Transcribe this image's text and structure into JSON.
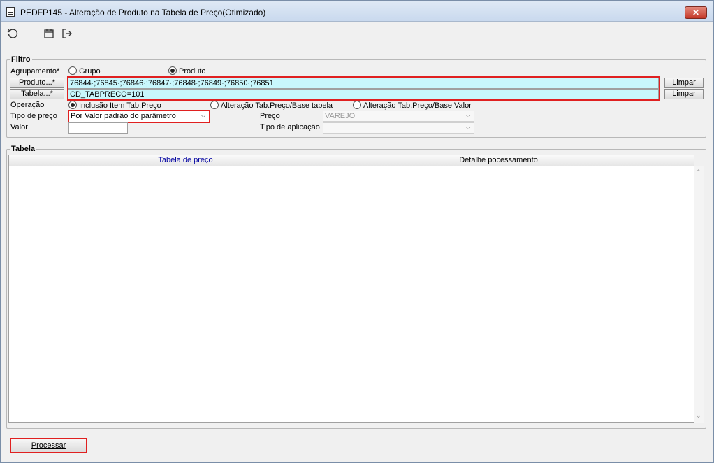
{
  "window": {
    "title": "PEDFP145 - Alteração de Produto na Tabela de Preço(Otimizado)",
    "close_label": "✕"
  },
  "toolbar": {
    "icons": [
      "refresh-icon",
      "calendar-icon",
      "logout-icon"
    ]
  },
  "filtro": {
    "legend": "Filtro",
    "agrupamento_label": "Agrupamento*",
    "grupo_label": "Grupo",
    "produto_label": "Produto",
    "agrupamento_selected": "Produto",
    "produto_button": "Produto...*",
    "produto_value": "76844·;76845·;76846·;76847·;76848·;76849·;76850·;76851",
    "tabela_button": "Tabela...*",
    "tabela_value": "CD_TABPRECO=101",
    "limpar1": "Limpar",
    "limpar2": "Limpar",
    "operacao_label": "Operação",
    "op1": "Inclusão Item Tab.Preço",
    "op2": "Alteração Tab.Preço/Base tabela",
    "op3": "Alteração Tab.Preço/Base Valor",
    "operacao_selected": "Inclusão Item Tab.Preço",
    "tipo_preco_label": "Tipo de preço",
    "tipo_preco_value": "Por Valor padrão do parâmetro",
    "preco_label": "Preço",
    "preco_value": "VAREJO",
    "valor_label": "Valor",
    "valor_value": "",
    "tipo_aplicacao_label": "Tipo de aplicação",
    "tipo_aplicacao_value": ""
  },
  "tabela": {
    "legend": "Tabela",
    "columns": [
      "Tabela de preço",
      "Detalhe pocessamento"
    ],
    "header_color": "#0000a0"
  },
  "footer": {
    "processar": "Processar"
  },
  "colors": {
    "highlight": "#e02020",
    "cyan_field": "#c8f7fc"
  }
}
